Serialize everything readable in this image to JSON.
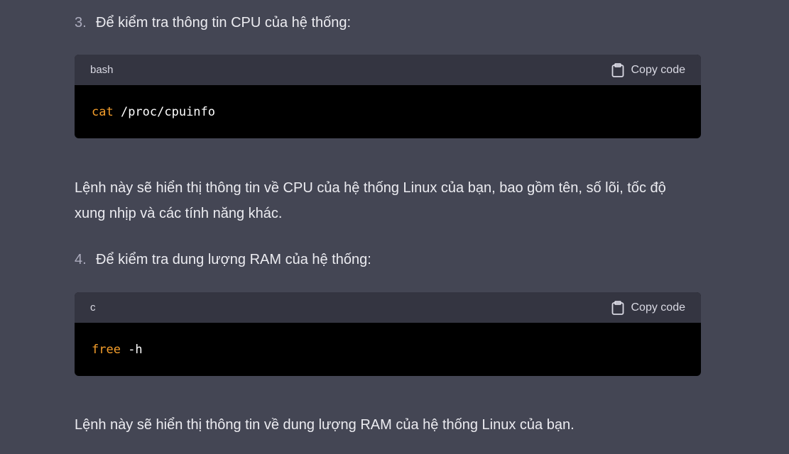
{
  "steps": [
    {
      "number": "3.",
      "text": "Để kiểm tra thông tin CPU của hệ thống:"
    },
    {
      "number": "4.",
      "text": "Để kiểm tra dung lượng RAM của hệ thống:"
    }
  ],
  "code_blocks": [
    {
      "language": "bash",
      "copy_label": "Copy code",
      "keyword": "cat",
      "rest": " /proc/cpuinfo"
    },
    {
      "language": "c",
      "copy_label": "Copy code",
      "keyword": "free",
      "rest": " -h"
    }
  ],
  "paragraphs": [
    "Lệnh này sẽ hiển thị thông tin về CPU của hệ thống Linux của bạn, bao gồm tên, số lõi, tốc độ xung nhịp và các tính năng khác.",
    "Lệnh này sẽ hiển thị thông tin về dung lượng RAM của hệ thống Linux của bạn."
  ],
  "colors": {
    "background": "#444654",
    "code_header": "#343541",
    "code_body": "#000000",
    "keyword": "#f59e2b"
  },
  "icons": {
    "copy": "clipboard-icon"
  }
}
